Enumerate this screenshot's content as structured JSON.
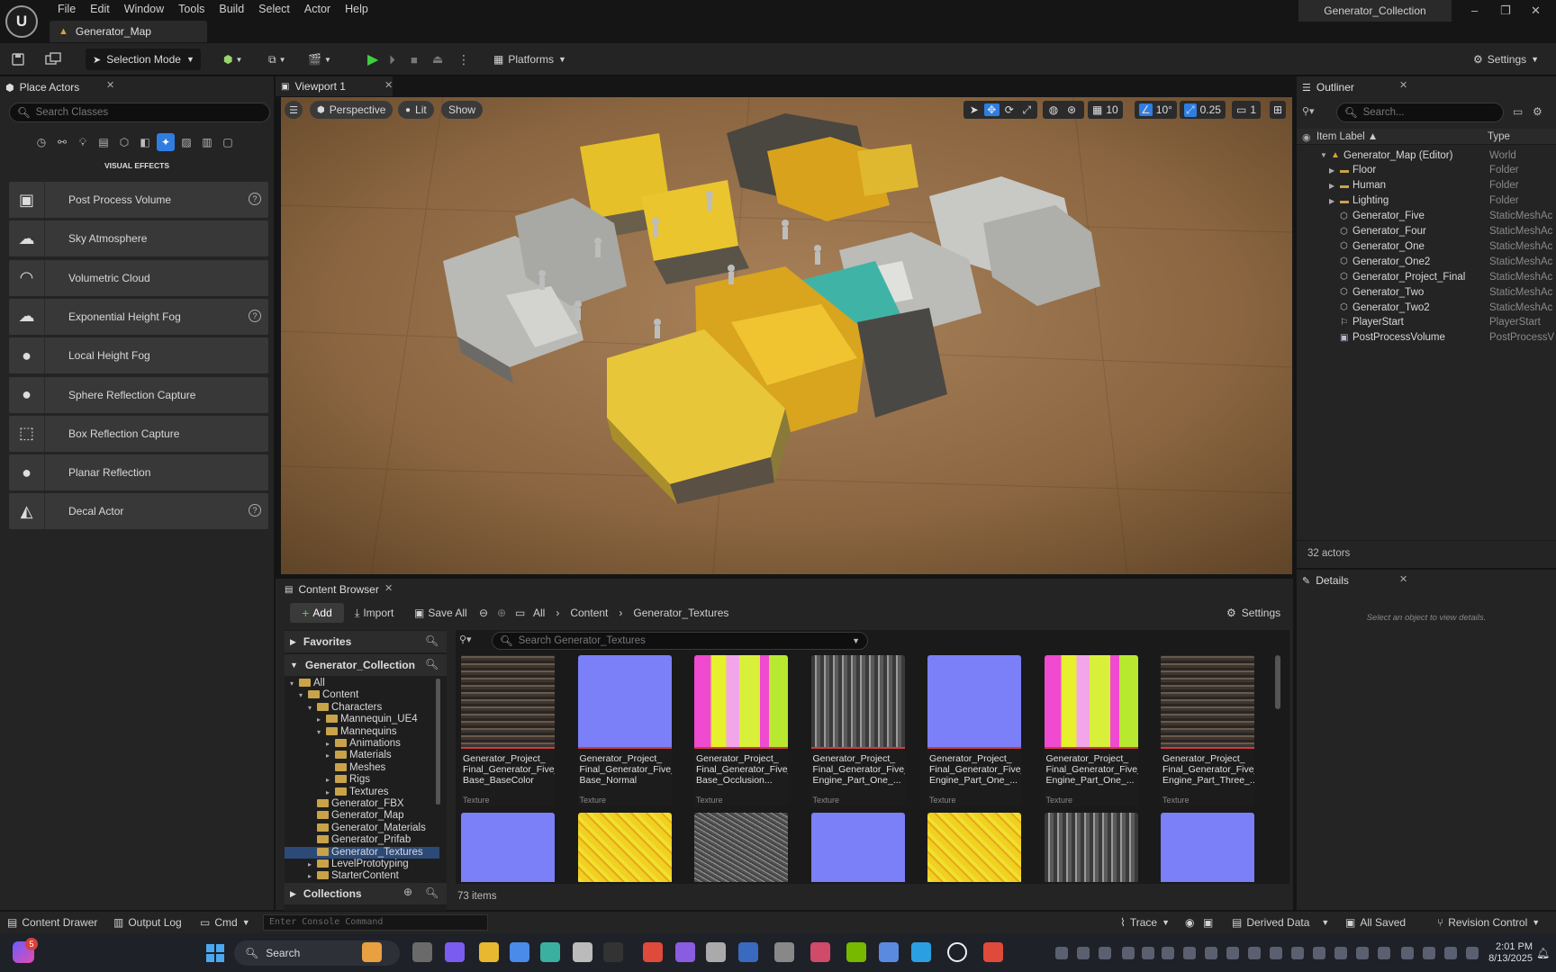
{
  "app": {
    "logo_text": "U",
    "menu": [
      "File",
      "Edit",
      "Window",
      "Tools",
      "Build",
      "Select",
      "Actor",
      "Help"
    ],
    "document_tab": "Generator_Map",
    "project_name": "Generator_Collection",
    "window_controls": [
      "–",
      "❐",
      "✕"
    ]
  },
  "toolbar": {
    "selection_mode": "Selection Mode",
    "platforms": "Platforms",
    "settings": "Settings"
  },
  "place_actors": {
    "title": "Place Actors",
    "search_placeholder": "Search Classes",
    "category": "VISUAL EFFECTS",
    "items": [
      {
        "label": "Post Process Volume",
        "icon": "post-process-icon",
        "help": true
      },
      {
        "label": "Sky Atmosphere",
        "icon": "sky-atmosphere-icon",
        "help": false
      },
      {
        "label": "Volumetric Cloud",
        "icon": "cloud-icon",
        "help": false
      },
      {
        "label": "Exponential Height Fog",
        "icon": "fog-icon",
        "help": true
      },
      {
        "label": "Local Height Fog",
        "icon": "sphere-icon",
        "help": false
      },
      {
        "label": "Sphere Reflection Capture",
        "icon": "sphere-icon",
        "help": false
      },
      {
        "label": "Box Reflection Capture",
        "icon": "box-icon",
        "help": false
      },
      {
        "label": "Planar Reflection",
        "icon": "sphere-icon",
        "help": false
      },
      {
        "label": "Decal Actor",
        "icon": "decal-icon",
        "help": true
      }
    ]
  },
  "viewport": {
    "tab": "Viewport 1",
    "perspective": "Perspective",
    "lit": "Lit",
    "show": "Show",
    "grid_snap": "10",
    "rotate_snap": "10°",
    "scale_snap": "0.25",
    "camera_speed": "1"
  },
  "outliner": {
    "title": "Outliner",
    "search_placeholder": "Search...",
    "col_label": "Item Label ▲",
    "col_type": "Type",
    "rows": [
      {
        "name": "Generator_Map (Editor)",
        "type": "World",
        "kind": "world",
        "depth": 0
      },
      {
        "name": "Floor",
        "type": "Folder",
        "kind": "folder",
        "depth": 1
      },
      {
        "name": "Human",
        "type": "Folder",
        "kind": "folder",
        "depth": 1
      },
      {
        "name": "Lighting",
        "type": "Folder",
        "kind": "folder",
        "depth": 1
      },
      {
        "name": "Generator_Five",
        "type": "StaticMeshAc",
        "kind": "mesh",
        "depth": 1
      },
      {
        "name": "Generator_Four",
        "type": "StaticMeshAc",
        "kind": "mesh",
        "depth": 1
      },
      {
        "name": "Generator_One",
        "type": "StaticMeshAc",
        "kind": "mesh",
        "depth": 1
      },
      {
        "name": "Generator_One2",
        "type": "StaticMeshAc",
        "kind": "mesh",
        "depth": 1
      },
      {
        "name": "Generator_Project_Final",
        "type": "StaticMeshAc",
        "kind": "mesh",
        "depth": 1
      },
      {
        "name": "Generator_Two",
        "type": "StaticMeshAc",
        "kind": "mesh",
        "depth": 1
      },
      {
        "name": "Generator_Two2",
        "type": "StaticMeshAc",
        "kind": "mesh",
        "depth": 1
      },
      {
        "name": "PlayerStart",
        "type": "PlayerStart",
        "kind": "player",
        "depth": 1
      },
      {
        "name": "PostProcessVolume",
        "type": "PostProcessV",
        "kind": "ppv",
        "depth": 1
      }
    ],
    "actor_count": "32 actors"
  },
  "details": {
    "title": "Details",
    "empty_text": "Select an object to view details."
  },
  "content_browser": {
    "tab": "Content Browser",
    "add": "Add",
    "import": "Import",
    "save_all": "Save All",
    "breadcrumb": [
      "All",
      "Content",
      "Generator_Textures"
    ],
    "settings": "Settings",
    "favorites": "Favorites",
    "collection_root": "Generator_Collection",
    "search_placeholder": "Search Generator_Textures",
    "collections": "Collections",
    "item_count": "73 items",
    "tree": [
      {
        "label": "All",
        "depth": 0,
        "arrow": "▾"
      },
      {
        "label": "Content",
        "depth": 1,
        "arrow": "▾"
      },
      {
        "label": "Characters",
        "depth": 2,
        "arrow": "▾"
      },
      {
        "label": "Mannequin_UE4",
        "depth": 3,
        "arrow": "▸"
      },
      {
        "label": "Mannequins",
        "depth": 3,
        "arrow": "▾"
      },
      {
        "label": "Animations",
        "depth": 4,
        "arrow": "▸"
      },
      {
        "label": "Materials",
        "depth": 4,
        "arrow": "▸"
      },
      {
        "label": "Meshes",
        "depth": 4,
        "arrow": ""
      },
      {
        "label": "Rigs",
        "depth": 4,
        "arrow": "▸"
      },
      {
        "label": "Textures",
        "depth": 4,
        "arrow": "▸"
      },
      {
        "label": "Generator_FBX",
        "depth": 2,
        "arrow": ""
      },
      {
        "label": "Generator_Map",
        "depth": 2,
        "arrow": ""
      },
      {
        "label": "Generator_Materials",
        "depth": 2,
        "arrow": ""
      },
      {
        "label": "Generator_Prifab",
        "depth": 2,
        "arrow": ""
      },
      {
        "label": "Generator_Textures",
        "depth": 2,
        "arrow": "",
        "selected": true
      },
      {
        "label": "LevelPrototyping",
        "depth": 2,
        "arrow": "▸"
      },
      {
        "label": "StarterContent",
        "depth": 2,
        "arrow": "▸"
      }
    ],
    "assets": [
      {
        "name": "Generator_Project_\nFinal_Generator_Five_\nBase_BaseColor",
        "type": "Texture",
        "pattern": "basecolor"
      },
      {
        "name": "Generator_Project_\nFinal_Generator_Five_\nBase_Normal",
        "type": "Texture",
        "pattern": "normal"
      },
      {
        "name": "Generator_Project_\nFinal_Generator_Five_\nBase_Occlusion...",
        "type": "Texture",
        "pattern": "orm"
      },
      {
        "name": "Generator_Project_\nFinal_Generator_Five_\nEngine_Part_One_...",
        "type": "Texture",
        "pattern": "gray"
      },
      {
        "name": "Generator_Project_\nFinal_Generator_Five_\nEngine_Part_One_...",
        "type": "Texture",
        "pattern": "normal"
      },
      {
        "name": "Generator_Project_\nFinal_Generator_Five_\nEngine_Part_One_...",
        "type": "Texture",
        "pattern": "orm"
      },
      {
        "name": "Generator_Project_\nFinal_Generator_Five_\nEngine_Part_Three_...",
        "type": "Texture",
        "pattern": "basecolor"
      },
      {
        "name": "",
        "type": "",
        "pattern": "normal"
      },
      {
        "name": "",
        "type": "",
        "pattern": "yellow"
      },
      {
        "name": "",
        "type": "",
        "pattern": "noise"
      },
      {
        "name": "",
        "type": "",
        "pattern": "normal"
      },
      {
        "name": "",
        "type": "",
        "pattern": "yellow"
      },
      {
        "name": "",
        "type": "",
        "pattern": "gray"
      },
      {
        "name": "",
        "type": "",
        "pattern": "normal"
      }
    ]
  },
  "statusbar": {
    "content_drawer": "Content Drawer",
    "output_log": "Output Log",
    "cmd": "Cmd",
    "console_placeholder": "Enter Console Command",
    "trace": "Trace",
    "derived_data": "Derived Data",
    "all_saved": "All Saved",
    "revision_control": "Revision Control"
  },
  "taskbar": {
    "search": "Search",
    "time": "2:01 PM",
    "date": "8/13/2025",
    "notification_count": "5"
  },
  "colors": {
    "accent_blue": "#2f7de1",
    "play_green": "#3ecf3e",
    "normal_map": "#7b7ff8",
    "selected_row": "#2c4a78"
  }
}
